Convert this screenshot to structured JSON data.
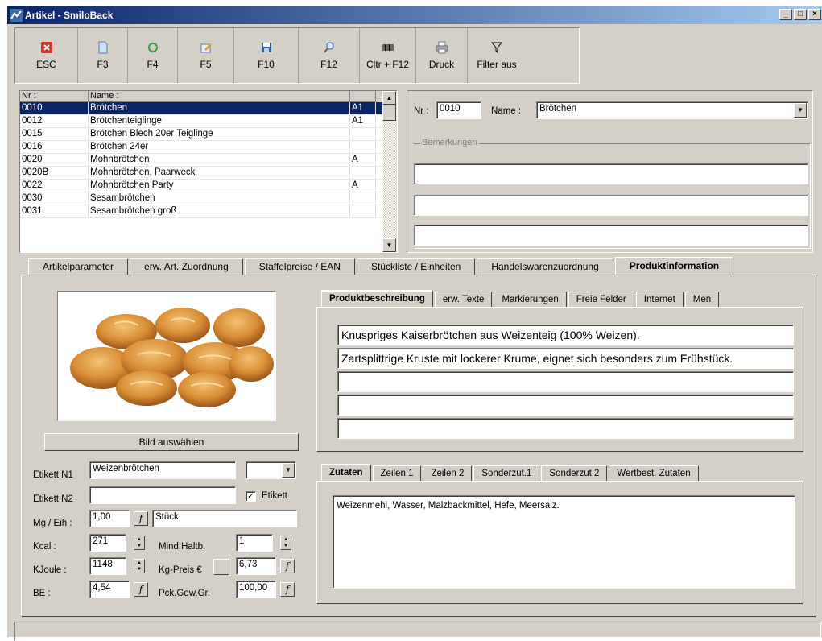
{
  "window": {
    "title": "Artikel - SmiloBack",
    "controls": [
      "_",
      "□",
      "×"
    ]
  },
  "toolbar": [
    {
      "label": "ESC",
      "icon": "close-x-icon"
    },
    {
      "label": "F3",
      "icon": "new-document-icon"
    },
    {
      "label": "F4",
      "icon": "refresh-icon"
    },
    {
      "label": "F5",
      "icon": "edit-icon"
    },
    {
      "label": "F10",
      "icon": "save-disk-icon"
    },
    {
      "label": "F12",
      "icon": "search-magnifier-icon"
    },
    {
      "label": "Cltr + F12",
      "icon": "barcode-icon"
    },
    {
      "label": "Druck",
      "icon": "printer-icon"
    },
    {
      "label": "Filter aus",
      "icon": "filter-icon"
    }
  ],
  "list": {
    "headers": [
      "Nr :",
      "Name :",
      ""
    ],
    "rows": [
      [
        "0010",
        "Brötchen",
        "A1"
      ],
      [
        "0012",
        "Brötchenteiglinge",
        "A1"
      ],
      [
        "0015",
        "Brötchen Blech 20er Teiglinge",
        ""
      ],
      [
        "0016",
        "Brötchen 24er",
        ""
      ],
      [
        "0020",
        "Mohnbrötchen",
        "A"
      ],
      [
        "0020B",
        "Mohnbrötchen, Paarweck",
        ""
      ],
      [
        "0022",
        "Mohnbrötchen Party",
        "A"
      ],
      [
        "0030",
        "Sesambrötchen",
        ""
      ],
      [
        "0031",
        "Sesambrötchen groß",
        ""
      ]
    ]
  },
  "detail": {
    "nr_label": "Nr :",
    "nr_value": "0010",
    "name_label": "Name :",
    "name_value": "Brötchen",
    "remarks_title": "Bemerkungen"
  },
  "main_tabs": [
    "Artikelparameter",
    "erw. Art. Zuordnung",
    "Staffelpreise / EAN",
    "Stückliste / Einheiten",
    "Handelswarenzuordnung",
    "Produktinformation"
  ],
  "image_button": "Bild auswählen",
  "fields": {
    "etikett_n1_label": "Etikett N1",
    "etikett_n1": "Weizenbrötchen",
    "etikett_n2_label": "Etikett N2",
    "etikett_n2": "",
    "etikett_check_label": "Etikett",
    "etikett_checked": "✓",
    "mg_label": "Mg / Eih :",
    "mg_value": "1,00",
    "mg_unit": "Stück",
    "kcal_label": "Kcal :",
    "kcal_value": "271",
    "mind_label": "Mind.Haltb.",
    "mind_value": "1",
    "kjoule_label": "KJoule :",
    "kjoule_value": "1148",
    "kgpreis_label": "Kg-Preis €",
    "kgpreis_value": "6,73",
    "be_label": "BE :",
    "be_value": "4,54",
    "pck_label": "Pck.Gew.Gr.",
    "pck_value": "100,00",
    "f_glyph": "f"
  },
  "desc_tabs": [
    "Produktbeschreibung",
    "erw. Texte",
    "Markierungen",
    "Freie Felder",
    "Internet",
    "Men"
  ],
  "description_lines": [
    "Knuspriges Kaiserbrötchen aus Weizenteig (100% Weizen).",
    "Zartsplittrige Kruste mit lockerer Krume, eignet sich besonders zum Frühstück.",
    "",
    "",
    ""
  ],
  "zutaten_tabs": [
    "Zutaten",
    "Zeilen 1",
    "Zeilen 2",
    "Sonderzut.1",
    "Sonderzut.2",
    "Wertbest. Zutaten"
  ],
  "zutaten_text": "Weizenmehl, Wasser, Malzbackmittel, Hefe, Meersalz.",
  "colors": {
    "titlebar": "#0a246a",
    "selection": "#0a246a",
    "face": "#d4d0c8"
  }
}
